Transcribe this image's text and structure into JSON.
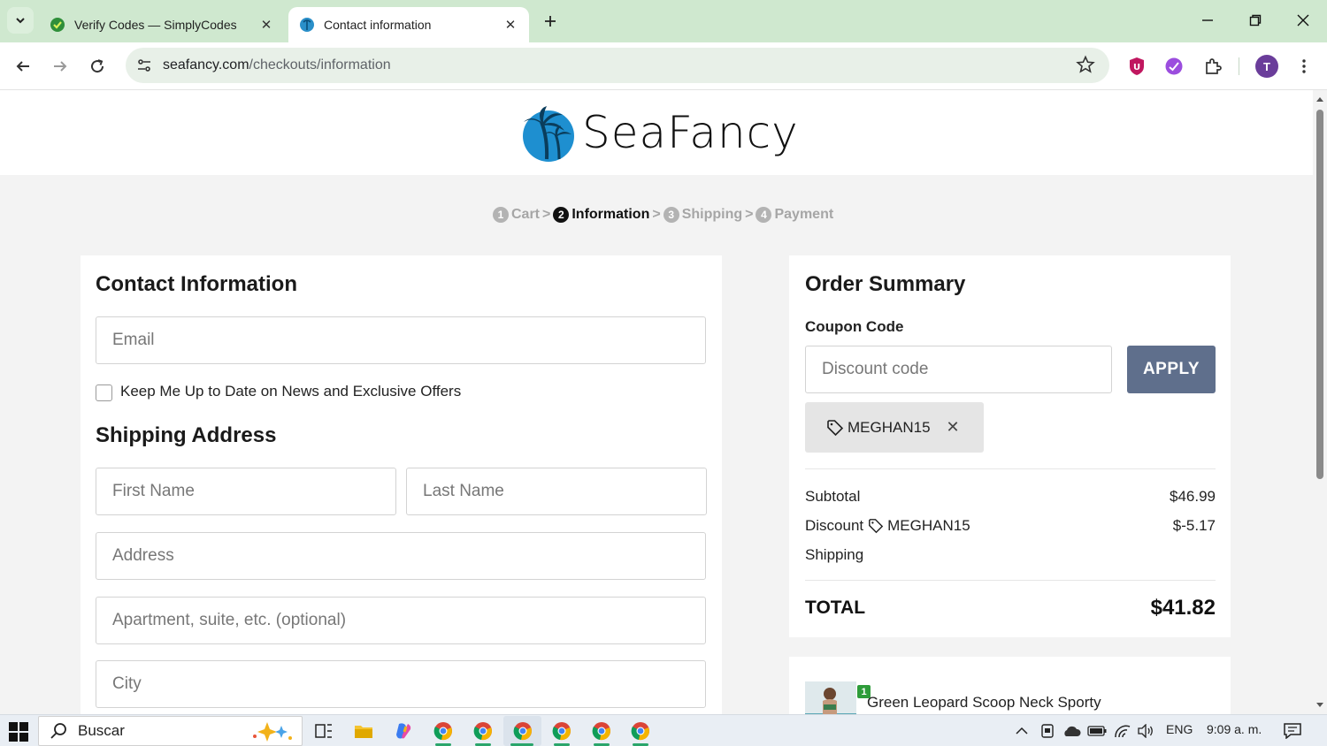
{
  "browser": {
    "tabs": [
      {
        "title": "Verify Codes — SimplyCodes",
        "active": false
      },
      {
        "title": "Contact information",
        "active": true
      }
    ],
    "url_host": "seafancy.com",
    "url_path": "/checkouts/information",
    "profile_initial": "T"
  },
  "site": {
    "logo_text": "SeaFancy"
  },
  "breadcrumb": {
    "steps": [
      {
        "num": "1",
        "label": "Cart"
      },
      {
        "num": "2",
        "label": "Information"
      },
      {
        "num": "3",
        "label": "Shipping"
      },
      {
        "num": "4",
        "label": "Payment"
      }
    ],
    "separator": ">"
  },
  "contact": {
    "title": "Contact Information",
    "email_placeholder": "Email",
    "newsletter_label": "Keep Me Up to Date on News and Exclusive Offers"
  },
  "shipping": {
    "title": "Shipping Address",
    "first_name_placeholder": "First Name",
    "last_name_placeholder": "Last Name",
    "address_placeholder": "Address",
    "apartment_placeholder": "Apartment, suite, etc. (optional)",
    "city_placeholder": "City"
  },
  "summary": {
    "title": "Order Summary",
    "coupon_label": "Coupon Code",
    "discount_placeholder": "Discount code",
    "apply_label": "APPLY",
    "applied_code": "MEGHAN15",
    "remove_glyph": "✕",
    "subtotal_label": "Subtotal",
    "subtotal_value": "$46.99",
    "discount_label": "Discount",
    "discount_code": "MEGHAN15",
    "discount_value": "$-5.17",
    "shipping_label": "Shipping",
    "total_label": "TOTAL",
    "total_value": "$41.82"
  },
  "product": {
    "quantity": "1",
    "name": "Green Leopard Scoop Neck Sporty Bikini Top with Pan Short Set"
  },
  "taskbar": {
    "search_label": "Buscar",
    "language": "ENG",
    "time": "9:09 a. m."
  },
  "colors": {
    "tabbar": "#cfe8cf",
    "apply_button": "#5f6f8c",
    "qty_badge": "#2e9c3a"
  }
}
